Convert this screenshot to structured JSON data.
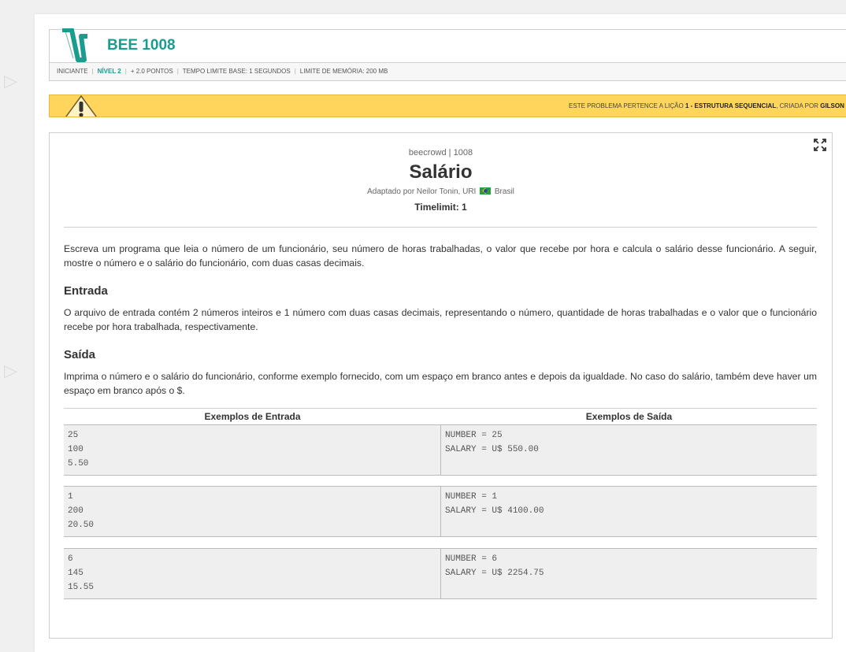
{
  "header": {
    "code": "BEE 1008",
    "meta": {
      "category": "INICIANTE",
      "level": "NÍVEL 2",
      "points": "+ 2.0 PONTOS",
      "time_limit": "TEMPO LIMITE BASE: 1 SEGUNDOS",
      "memory_limit": "LIMITE DE MEMÓRIA: 200 MB"
    }
  },
  "notice": {
    "prefix": "ESTE PROBLEMA PERTENCE A LIÇÃO ",
    "lesson": "1 - ESTRUTURA SEQUENCIAL",
    "middle": ", CRIADA POR ",
    "creator": "GILSON F"
  },
  "problem": {
    "source": "beecrowd | 1008",
    "title": "Salário",
    "author_prefix": "Adaptado por Neilor Tonin, URI",
    "author_country": "Brasil",
    "timelimit": "Timelimit: 1",
    "description": "Escreva um programa que leia o número de um funcionário, seu número de horas trabalhadas, o valor que recebe por hora e calcula o salário desse funcionário. A seguir, mostre o número e o salário do funcionário, com duas casas decimais.",
    "input_title": "Entrada",
    "input_text": "O arquivo de entrada contém 2 números inteiros e 1 número com duas casas decimais, representando o número, quantidade de horas trabalhadas e o valor que o funcionário recebe por hora trabalhada, respectivamente.",
    "output_title": "Saída",
    "output_text": "Imprima o número e o salário do funcionário, conforme exemplo fornecido, com um espaço em branco antes e depois da igualdade. No caso do salário, também deve haver um espaço em branco após o $."
  },
  "examples": {
    "input_header": "Exemplos de Entrada",
    "output_header": "Exemplos de Saída",
    "items": [
      {
        "input": "25\n100\n5.50",
        "output": "NUMBER = 25\nSALARY = U$ 550.00"
      },
      {
        "input": "1\n200\n20.50",
        "output": "NUMBER = 1\nSALARY = U$ 4100.00"
      },
      {
        "input": "6\n145\n15.55",
        "output": "NUMBER = 6\nSALARY = U$ 2254.75"
      }
    ]
  },
  "colors": {
    "accent": "#1a9c8e",
    "notice_bg": "#ffd55c"
  },
  "icons": {
    "expand": "expand-icon",
    "warning": "warning-icon",
    "logo": "beecrowd-logo"
  }
}
